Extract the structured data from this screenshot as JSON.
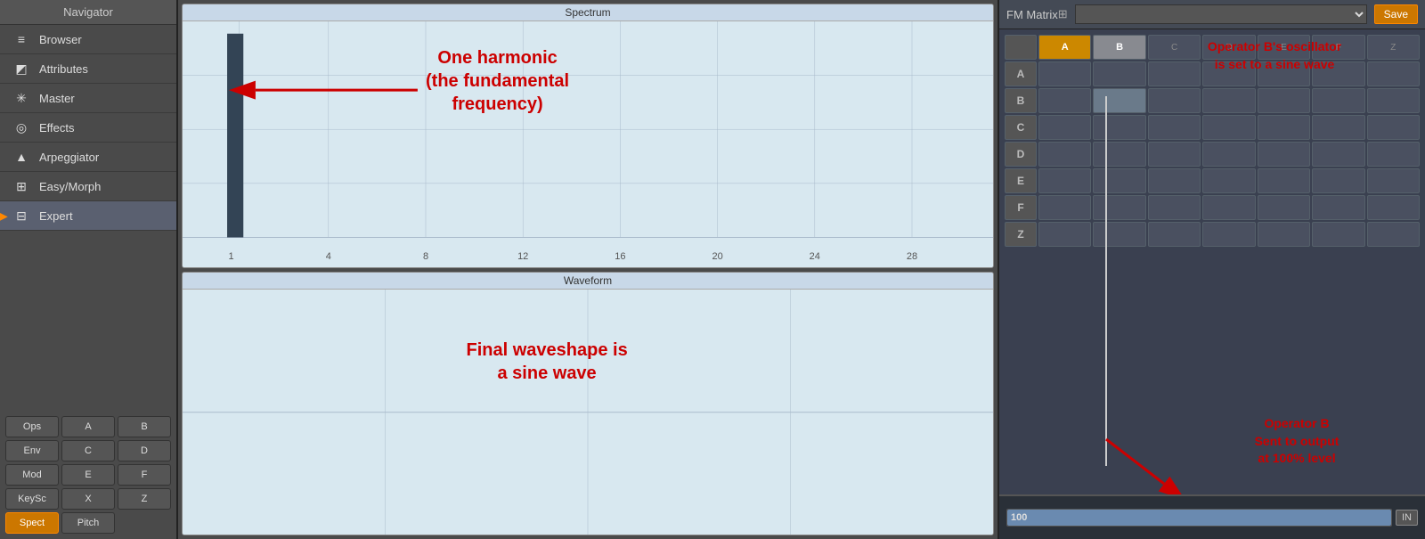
{
  "topBar": {
    "leftTitle": "Navigator",
    "centerTitle": "Spectrum",
    "rightTitle": "FM Matrix",
    "rightIcon": "+"
  },
  "sidebar": {
    "title": "Navigator",
    "items": [
      {
        "id": "browser",
        "label": "Browser",
        "icon": "≡"
      },
      {
        "id": "attributes",
        "label": "Attributes",
        "icon": "◩"
      },
      {
        "id": "master",
        "label": "Master",
        "icon": "✳"
      },
      {
        "id": "effects",
        "label": "Effects",
        "icon": "◎"
      },
      {
        "id": "arpeggiator",
        "label": "Arpeggiator",
        "icon": "▲"
      },
      {
        "id": "easy-morph",
        "label": "Easy/Morph",
        "icon": "⊞"
      },
      {
        "id": "expert",
        "label": "Expert",
        "icon": "⊟",
        "active": true
      }
    ],
    "gridButtons": [
      {
        "id": "ops",
        "label": "Ops",
        "active": false
      },
      {
        "id": "a",
        "label": "A",
        "active": false
      },
      {
        "id": "b",
        "label": "B",
        "active": false
      },
      {
        "id": "env",
        "label": "Env",
        "active": false
      },
      {
        "id": "c",
        "label": "C",
        "active": false
      },
      {
        "id": "d",
        "label": "D",
        "active": false
      },
      {
        "id": "mod",
        "label": "Mod",
        "active": false
      },
      {
        "id": "e",
        "label": "E",
        "active": false
      },
      {
        "id": "f",
        "label": "F",
        "active": false
      },
      {
        "id": "keysc",
        "label": "KeySc",
        "active": false
      },
      {
        "id": "x",
        "label": "X",
        "active": false
      },
      {
        "id": "z",
        "label": "Z",
        "active": false
      },
      {
        "id": "spect",
        "label": "Spect",
        "active": true
      },
      {
        "id": "pitch",
        "label": "Pitch",
        "active": false
      }
    ]
  },
  "spectrum": {
    "title": "Spectrum",
    "annotation": "One harmonic\n(the fundamental\nfrequency)",
    "xLabels": [
      "1",
      "4",
      "8",
      "12",
      "16",
      "20",
      "24",
      "28"
    ]
  },
  "waveform": {
    "title": "Waveform",
    "annotation": "Final waveshape is\na sine wave"
  },
  "fmMatrix": {
    "title": "FM Matrix",
    "saveLabel": "Save",
    "operatorBAnnotation": "Operator B's oscillator\nis set to a sine wave",
    "operatorBOutputAnnotation": "Operator B\nSent to output\nat 100% level",
    "outputValue": "100",
    "inLabel": "IN",
    "operators": [
      "A",
      "B",
      "C",
      "D",
      "E",
      "F",
      "Z"
    ],
    "rows": [
      "A",
      "B",
      "C",
      "D",
      "E",
      "F",
      "Z"
    ]
  }
}
